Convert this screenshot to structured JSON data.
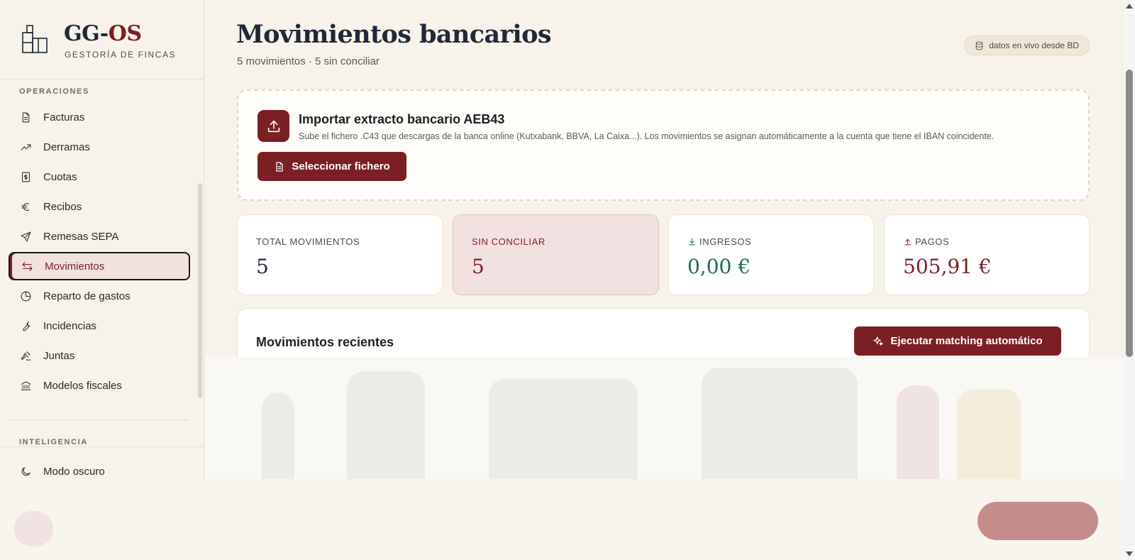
{
  "brand": {
    "name_part1": "GG-",
    "name_part2": "OS",
    "subtitle": "GESTORÍA DE FINCAS"
  },
  "sidebar": {
    "section_operaciones": "OPERACIONES",
    "items": [
      {
        "label": "Facturas",
        "icon": "file-text-icon"
      },
      {
        "label": "Derramas",
        "icon": "trending-up-icon"
      },
      {
        "label": "Cuotas",
        "icon": "receipt-dollar-icon"
      },
      {
        "label": "Recibos",
        "icon": "euro-icon"
      },
      {
        "label": "Remesas SEPA",
        "icon": "send-icon"
      },
      {
        "label": "Movimientos",
        "icon": "arrows-swap-icon",
        "active": true
      },
      {
        "label": "Reparto de gastos",
        "icon": "pie-chart-icon"
      },
      {
        "label": "Incidencias",
        "icon": "wrench-icon"
      },
      {
        "label": "Juntas",
        "icon": "gavel-icon"
      },
      {
        "label": "Modelos fiscales",
        "icon": "bank-icon"
      }
    ],
    "section_inteligencia": "INTELIGENCIA",
    "dark_mode_label": "Modo oscuro"
  },
  "header": {
    "title": "Movimientos bancarios",
    "subtitle": "5 movimientos · 5 sin conciliar",
    "badge": "datos en vivo desde BD"
  },
  "import": {
    "title": "Importar extracto bancario AEB43",
    "description": "Sube el fichero .C43 que descargas de la banca online (Kutxabank, BBVA, La Caixa...). Los movimientos se asignan automáticamente a la cuenta que tiene el IBAN coincidente.",
    "button": "Seleccionar fichero"
  },
  "stats": [
    {
      "label": "TOTAL MOVIMIENTOS",
      "value": "5"
    },
    {
      "label": "SIN CONCILIAR",
      "value": "5"
    },
    {
      "label": "INGRESOS",
      "value": "0,00 €"
    },
    {
      "label": "PAGOS",
      "value": "505,91 €"
    }
  ],
  "recent": {
    "title": "Movimientos recientes",
    "button": "Ejecutar matching automático"
  },
  "colors": {
    "accent": "#7c1f24",
    "income": "#1f6b4f",
    "expense": "#7c1f24",
    "background": "#f7f2ea"
  }
}
